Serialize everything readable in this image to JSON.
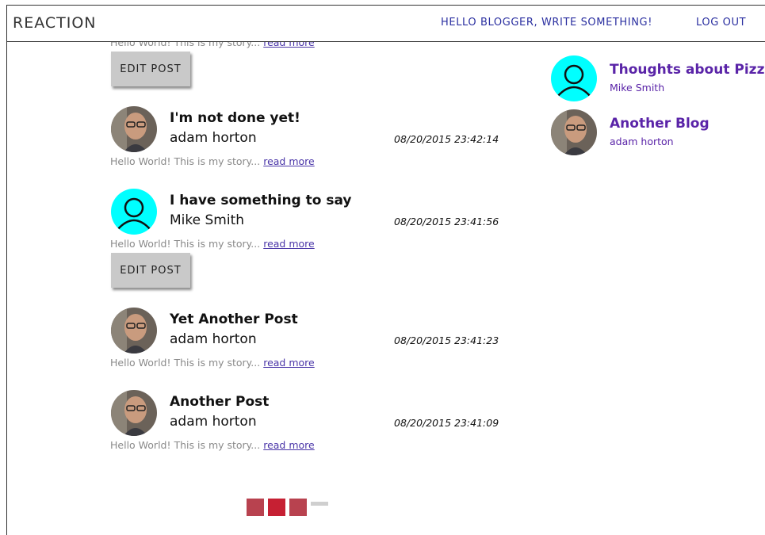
{
  "header": {
    "brand": "REACTION",
    "hello_link": "HELLO BLOGGER, WRITE SOMETHING!",
    "logout_link": "LOG OUT"
  },
  "colors": {
    "link": "#2a2fa0",
    "sidebar_link": "#5a24a8",
    "pager_active": "#c62033",
    "pager": "#b8424f",
    "default_avatar_bg": "#00ffff"
  },
  "top_partial": {
    "snippet": "Hello World! This is my story...",
    "read_more": "read more",
    "edit_label": "EDIT POST"
  },
  "posts": [
    {
      "title": "I'm not done yet!",
      "author": "adam horton",
      "date": "08/20/2015 23:42:14",
      "snippet": "Hello World! This is my story...",
      "read_more": "read more",
      "avatar": "photo-avatar"
    },
    {
      "title": "I have something to say",
      "author": "Mike Smith",
      "date": "08/20/2015 23:41:56",
      "snippet": "Hello World! This is my story...",
      "read_more": "read more",
      "avatar": "default-user-icon",
      "edit_label": "EDIT POST"
    },
    {
      "title": "Yet Another Post",
      "author": "adam horton",
      "date": "08/20/2015 23:41:23",
      "snippet": "Hello World! This is my story...",
      "read_more": "read more",
      "avatar": "photo-avatar"
    },
    {
      "title": "Another Post",
      "author": "adam horton",
      "date": "08/20/2015 23:41:09",
      "snippet": "Hello World! This is my story...",
      "read_more": "read more",
      "avatar": "photo-avatar"
    }
  ],
  "sidebar": {
    "blogs": [
      {
        "title": "Thoughts about Pizza",
        "author": "Mike Smith",
        "avatar": "default-user-icon"
      },
      {
        "title": "Another Blog",
        "author": "adam horton",
        "avatar": "photo-avatar"
      }
    ]
  },
  "pagination": {
    "pages": 3,
    "current_page": 2
  }
}
